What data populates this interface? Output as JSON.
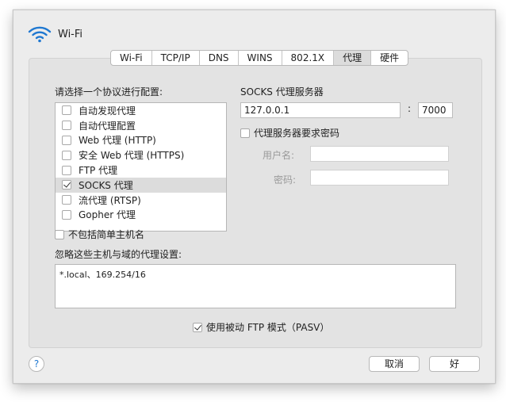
{
  "window": {
    "title": "Wi-Fi",
    "icon": "wifi-icon"
  },
  "tabs": [
    {
      "label": "Wi-Fi",
      "active": false
    },
    {
      "label": "TCP/IP",
      "active": false
    },
    {
      "label": "DNS",
      "active": false
    },
    {
      "label": "WINS",
      "active": false
    },
    {
      "label": "802.1X",
      "active": false
    },
    {
      "label": "代理",
      "active": true
    },
    {
      "label": "硬件",
      "active": false
    }
  ],
  "protocols": {
    "heading": "请选择一个协议进行配置:",
    "items": [
      {
        "label": "自动发现代理",
        "checked": false,
        "selected": false
      },
      {
        "label": "自动代理配置",
        "checked": false,
        "selected": false
      },
      {
        "label": "Web 代理 (HTTP)",
        "checked": false,
        "selected": false
      },
      {
        "label": "安全 Web 代理 (HTTPS)",
        "checked": false,
        "selected": false
      },
      {
        "label": "FTP 代理",
        "checked": false,
        "selected": false
      },
      {
        "label": "SOCKS 代理",
        "checked": true,
        "selected": true
      },
      {
        "label": "流代理 (RTSP)",
        "checked": false,
        "selected": false
      },
      {
        "label": "Gopher 代理",
        "checked": false,
        "selected": false
      }
    ]
  },
  "server": {
    "heading": "SOCKS 代理服务器",
    "host": "127.0.0.1",
    "separator": ":",
    "port": "7000",
    "requires_password_label": "代理服务器要求密码",
    "requires_password": false,
    "username_label": "用户名:",
    "username": "",
    "password_label": "密码:",
    "password": ""
  },
  "exclude_simple": {
    "label": "不包括简单主机名",
    "checked": false
  },
  "bypass": {
    "label": "忽略这些主机与域的代理设置:",
    "value": "*.local、169.254/16"
  },
  "passive_ftp": {
    "label": "使用被动 FTP 模式（PASV）",
    "checked": true
  },
  "buttons": {
    "help": "?",
    "cancel": "取消",
    "ok": "好"
  },
  "colors": {
    "accent": "#1f78d1",
    "window_bg": "#ececec",
    "panel_bg": "#e3e3e3"
  }
}
